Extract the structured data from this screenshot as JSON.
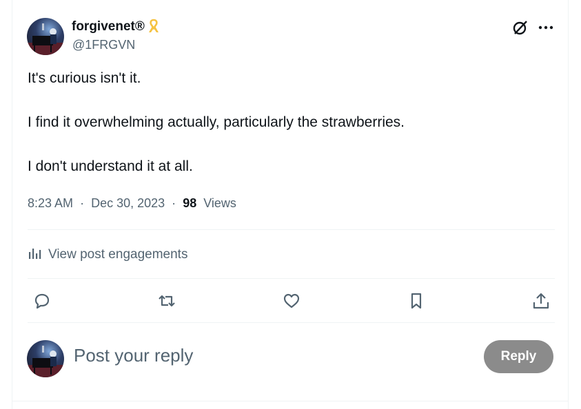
{
  "author": {
    "display_name": "forgivenet®",
    "handle": "@1FRGVN",
    "badge_icon": "yellow-ribbon-icon"
  },
  "post": {
    "lines": [
      "It's curious isn't it.",
      "I find it overwhelming actually, particularly the strawberries.",
      "I don't understand it at all."
    ],
    "time": "8:23 AM",
    "separator": "·",
    "date": "Dec 30, 2023",
    "views_count": "98",
    "views_label": "Views"
  },
  "engagements": {
    "label": "View post engagements",
    "icon": "bar-chart-icon"
  },
  "actions": {
    "reply_icon": "reply-bubble-icon",
    "repost_icon": "repost-icon",
    "like_icon": "heart-icon",
    "bookmark_icon": "bookmark-icon",
    "share_icon": "share-icon"
  },
  "composer": {
    "placeholder": "Post your reply",
    "button_label": "Reply",
    "button_color": "#8b8b8b"
  },
  "colors": {
    "text_primary": "#0f1419",
    "text_secondary": "#536471",
    "divider": "#eff3f4",
    "ribbon": "#f5c242"
  }
}
